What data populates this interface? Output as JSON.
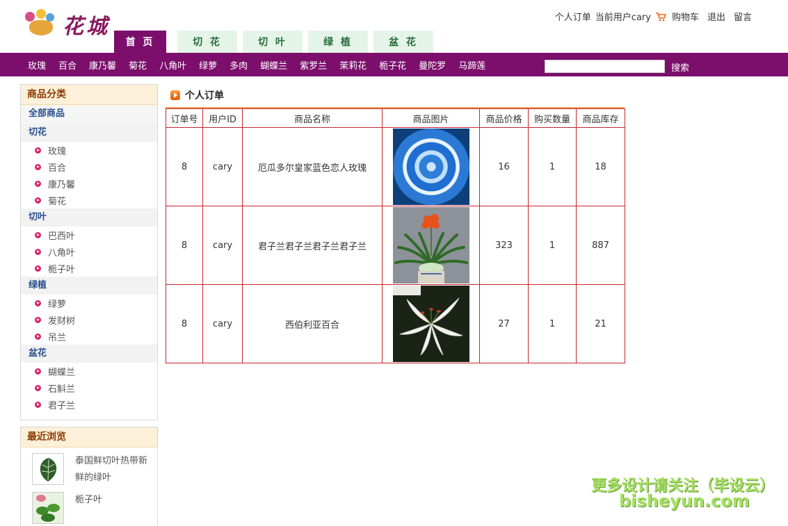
{
  "brand": {
    "logo_text": "花城"
  },
  "toplinks": {
    "orders": "个人订单",
    "current_user": "当前用户cary",
    "cart": "购物车",
    "logout": "退出",
    "message": "留言"
  },
  "main_tabs": [
    "首 页",
    "切 花",
    "切 叶",
    "绿 植",
    "盆 花"
  ],
  "categories": [
    "玫瑰",
    "百合",
    "康乃馨",
    "菊花",
    "八角叶",
    "绿萝",
    "多肉",
    "蝴蝶兰",
    "紫罗兰",
    "茉莉花",
    "栀子花",
    "曼陀罗",
    "马蹄莲"
  ],
  "search": {
    "button": "搜索",
    "value": ""
  },
  "sidebar": {
    "title": "商品分类",
    "all": "全部商品",
    "groups": [
      {
        "name": "切花",
        "items": [
          "玫瑰",
          "百合",
          "康乃馨",
          "菊花"
        ]
      },
      {
        "name": "切叶",
        "items": [
          "巴西叶",
          "八角叶",
          "栀子叶"
        ]
      },
      {
        "name": "绿植",
        "items": [
          "绿萝",
          "发财树",
          "吊兰"
        ]
      },
      {
        "name": "盆花",
        "items": [
          "蝴蝶兰",
          "石斛兰",
          "君子兰"
        ]
      }
    ]
  },
  "recent": {
    "title": "最近浏览",
    "items": [
      "泰国鲜切叶热带新鲜的绿叶",
      "栀子叶"
    ]
  },
  "main": {
    "title": "个人订单"
  },
  "table": {
    "headers": [
      "订单号",
      "用户ID",
      "商品名称",
      "商品图片",
      "商品价格",
      "购买数量",
      "商品库存"
    ],
    "rows": [
      {
        "order_id": "8",
        "user_id": "cary",
        "name": "厄瓜多尔皇家蓝色恋人玫瑰",
        "image": "blue-rose-image",
        "price": "16",
        "qty": "1",
        "stock": "18"
      },
      {
        "order_id": "8",
        "user_id": "cary",
        "name": "君子兰君子兰君子兰君子兰",
        "image": "clivia-image",
        "price": "323",
        "qty": "1",
        "stock": "887"
      },
      {
        "order_id": "8",
        "user_id": "cary",
        "name": "西伯利亚百合",
        "image": "white-lily-image",
        "price": "27",
        "qty": "1",
        "stock": "21"
      }
    ]
  },
  "watermark": {
    "line1": "更多设计请关注（毕设云）",
    "line2": "bisheyun.com"
  }
}
